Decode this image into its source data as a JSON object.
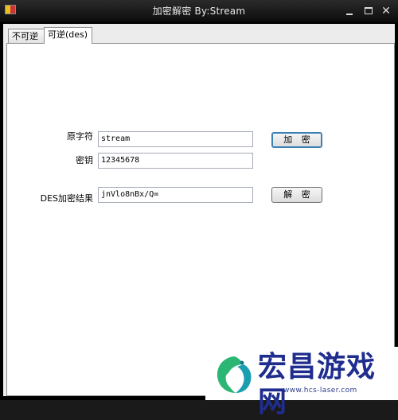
{
  "window": {
    "title": "加密解密   By:Stream"
  },
  "tabs": [
    {
      "label": "不可逆",
      "active": false
    },
    {
      "label": "可逆(des)",
      "active": true
    }
  ],
  "form": {
    "plaintext_label": "原字符",
    "plaintext_value": "stream",
    "key_label": "密钥",
    "key_value": "12345678",
    "result_label": "DES加密结果",
    "result_value": "jnVlo8nBx/Q=",
    "encrypt_label": "加 密",
    "decrypt_label": "解 密"
  },
  "watermark": {
    "brand": "宏昌游戏网",
    "url": "www.hcs-laser.com"
  },
  "colors": {
    "titlebar": "#0b0b0b",
    "client_bg": "#ececec",
    "panel_bg": "#ffffff",
    "watermark_text": "#1f2d8f",
    "logo_green": "#2bb673",
    "logo_teal": "#1a9fb0"
  },
  "icons": {
    "app": "app-icon",
    "minimize": "minimize-icon",
    "maximize": "maximize-icon",
    "close": "close-icon",
    "logo": "dragon-logo-icon"
  }
}
